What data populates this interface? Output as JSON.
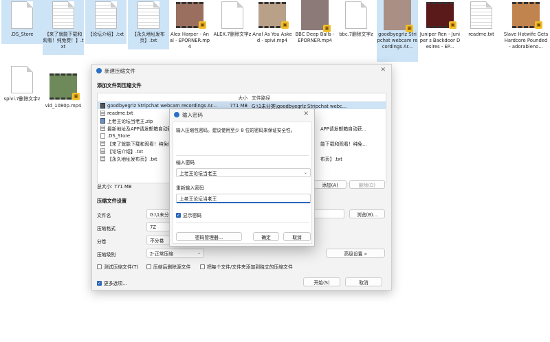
{
  "desktop": {
    "files": [
      {
        "label": ".DS_Store",
        "kind": "doc",
        "selected": true
      },
      {
        "label": "【来了就能下载和观看！纯免费！】.txt",
        "kind": "doc-lines",
        "selected": true
      },
      {
        "label": "【论坛介绍】.txt",
        "kind": "doc-lines",
        "selected": true
      },
      {
        "label": "【永久地址发布页】.txt",
        "kind": "doc-lines",
        "selected": true
      },
      {
        "label": "Alex Harper - Anal - EPORNER.mp4",
        "kind": "video",
        "selected": false
      },
      {
        "label": "ALEX.7删除文字z",
        "kind": "doc",
        "selected": false
      },
      {
        "label": "Anal As You Asked - spivi.mp4",
        "kind": "video",
        "selected": false
      },
      {
        "label": "BBC Deep Balls - EPORNER.mp4",
        "kind": "video",
        "selected": false
      },
      {
        "label": "bbc.7删除文字z",
        "kind": "doc",
        "selected": false
      },
      {
        "label": "goodbyegrlz Stripchat webcam recordings Ar...",
        "kind": "image",
        "selected": true
      },
      {
        "label": "Juniper Ren - Juniper s Backdoor Desires - EP...",
        "kind": "video",
        "selected": false
      },
      {
        "label": "readme.txt",
        "kind": "doc-lines",
        "selected": false
      },
      {
        "label": "Slave Hotwife Gets Hardcore Pounded - adorableno...",
        "kind": "video",
        "selected": false
      },
      {
        "label": "spivi.7删除文字z",
        "kind": "doc",
        "selected": false
      },
      {
        "label": "vid_1080p.mp4",
        "kind": "video",
        "selected": false
      }
    ]
  },
  "main_dialog": {
    "title": "新建压缩文件",
    "section_add": "添加文件到压缩文件",
    "columns": {
      "name": "",
      "size": "大小",
      "path": "文件路径"
    },
    "rows": [
      {
        "name": "goodbyegrlz Stripchat webcam recordings Ar...",
        "size": "771 MB",
        "path": "G:\\1未分类\\goodbyegrlz Stripchat webc...",
        "icon": "v",
        "highlight": true
      },
      {
        "name": "readme.txt",
        "size": "",
        "path": "",
        "icon": "t",
        "highlight": false
      },
      {
        "name": "上老王论坛当老王.zip",
        "size": "",
        "path": "",
        "icon": "z",
        "highlight": false
      },
      {
        "name": "最新地址及APP请发邮箱自动获...",
        "size": "",
        "path": "APP请发邮箱自动获...",
        "icon": "t",
        "highlight": false
      },
      {
        "name": ".DS_Store",
        "size": "",
        "path": "",
        "icon": "d",
        "highlight": false
      },
      {
        "name": "【来了就能下载和观看！纯免费...",
        "size": "",
        "path": "能下载和观看！纯免...",
        "icon": "t",
        "highlight": false
      },
      {
        "name": "【论坛介绍】.txt",
        "size": "",
        "path": "",
        "icon": "t",
        "highlight": false
      },
      {
        "name": "【永久地址发布页】.txt",
        "size": "",
        "path": "布页】.txt",
        "icon": "t",
        "highlight": false
      }
    ],
    "total_size": "总大小: 771 MB",
    "add_button": "添加(A)",
    "delete_button": "删除(D)",
    "section_settings": "压缩文件设置",
    "filename_label": "文件名",
    "filename_value": "G:\\1未分类",
    "browse_button": "浏览(B)...",
    "format_label": "压缩格式",
    "format_value": "7Z",
    "split_label": "分卷",
    "split_value": "不分卷",
    "level_label": "压缩级别",
    "level_value": "2-正常压缩",
    "advanced_button": "高级设置 »",
    "test_check": "测试压缩文件(T)",
    "delete_after_check": "压缩后删除源文件",
    "each_file_check": "把每个文件/文件夹添加到独立的压缩文件",
    "more_options": "更多选项...",
    "start_button": "开始(S)",
    "cancel_button": "取消"
  },
  "password_dialog": {
    "title": "输入密码",
    "hint": "输入压缩包密码。建议使用至少 8 位的密码来保证安全性。",
    "enter_label": "输入密码",
    "enter_value": "上老王论坛当老王",
    "reenter_label": "重新输入密码",
    "reenter_value": "上老王论坛当老王",
    "show_password": "显示密码",
    "manager_button": "密码管理器...",
    "ok_button": "确定",
    "cancel_button": "取消"
  },
  "colors": {
    "accent": "#2a66b8",
    "selection": "#cde4f7",
    "badge": "#f2c02b"
  }
}
